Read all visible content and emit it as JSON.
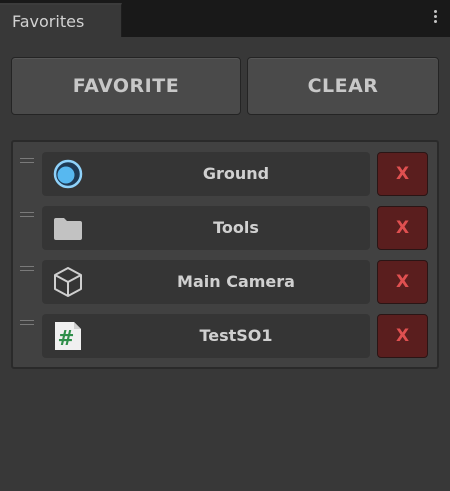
{
  "tab": {
    "title": "Favorites"
  },
  "toolbar": {
    "favorite_label": "FAVORITE",
    "clear_label": "CLEAR"
  },
  "items": [
    {
      "label": "Ground",
      "icon": "sphere-icon",
      "remove_label": "X"
    },
    {
      "label": "Tools",
      "icon": "folder-icon",
      "remove_label": "X"
    },
    {
      "label": "Main Camera",
      "icon": "cube-icon",
      "remove_label": "X"
    },
    {
      "label": "TestSO1",
      "icon": "script-file-icon",
      "remove_label": "X"
    }
  ],
  "colors": {
    "background": "#383838",
    "remove_button": "#5a1e1e",
    "remove_text": "#e05050",
    "sphere_accent": "#57b8f0",
    "script_accent": "#2f8f4a"
  }
}
